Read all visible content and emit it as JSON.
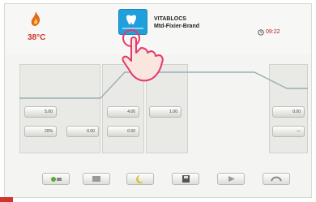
{
  "header": {
    "temperature": "38°C",
    "program_line1": "VITABLOCS",
    "program_line2": "Mtd-Fixier-Brand",
    "clock": "09:22"
  },
  "icons": {
    "temperature": "flame-icon",
    "program": "program-tile-icon",
    "hand": "touch-hand-icon",
    "clock": "clock-icon"
  },
  "parameters": [
    {
      "icon": "thermometer-icon",
      "value": "5.00"
    },
    {
      "icon": "ramp-icon",
      "value": "20%"
    },
    {
      "icon": "vacuum-icon",
      "value": "0.00"
    },
    {
      "icon": "thermometer-icon",
      "value": "4.00"
    },
    {
      "icon": "vacuum-icon",
      "value": "0.00"
    },
    {
      "icon": "thermometer-icon",
      "value": "1.00"
    },
    {
      "icon": "thermometer-icon",
      "value": "0.00"
    },
    {
      "icon": "cooling-icon",
      "value": "—"
    }
  ],
  "toolbar": [
    {
      "icon": "add-icon"
    },
    {
      "icon": "edit-icon"
    },
    {
      "icon": "night-icon"
    },
    {
      "icon": "save-icon"
    },
    {
      "icon": "play-icon"
    },
    {
      "icon": "return-icon"
    }
  ],
  "colors": {
    "accent": "#d0342c",
    "program_tile": "#1fa0dc",
    "graph_line": "#9ab0b4"
  }
}
